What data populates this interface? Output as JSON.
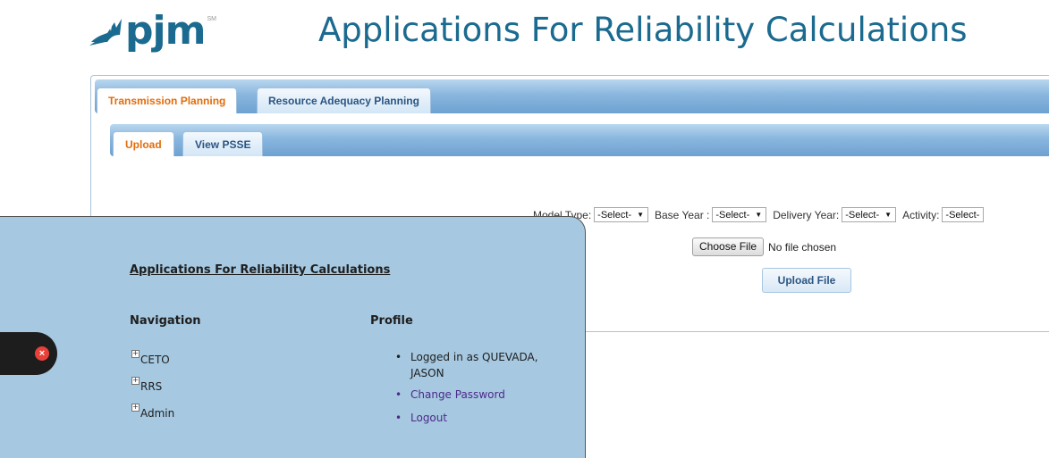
{
  "header": {
    "logo_text": "pjm",
    "logo_mark": "SM",
    "title": "Applications For Reliability Calculations"
  },
  "tabs": [
    {
      "label": "Transmission Planning",
      "active": true
    },
    {
      "label": "Resource Adequacy Planning",
      "active": false
    }
  ],
  "subtabs": [
    {
      "label": "Upload",
      "active": true
    },
    {
      "label": "View PSSE",
      "active": false
    }
  ],
  "filters": {
    "model_type_label": "Model Type:",
    "model_type_value": "-Select-",
    "base_year_label": "Base Year :",
    "base_year_value": "-Select-",
    "delivery_year_label": "Delivery Year:",
    "delivery_year_value": "-Select-",
    "activity_label": "Activity:",
    "activity_value": "-Select-"
  },
  "file": {
    "choose_label": "Choose File",
    "status": "No file chosen"
  },
  "upload_label": "Upload File",
  "overlay": {
    "title": "Applications For Reliability Calculations",
    "navigation_heading": "Navigation",
    "navigation_items": [
      "CETO",
      "RRS",
      "Admin"
    ],
    "profile_heading": "Profile",
    "logged_in": "Logged in as QUEVADA, JASON",
    "change_password": "Change Password",
    "logout": "Logout"
  },
  "icons": {
    "logo": "pjm-logo-icon",
    "close": "close-icon",
    "expand": "plus-expander-icon"
  },
  "colors": {
    "brand_blue": "#1b6a8f",
    "active_tab": "#e36c0a",
    "overlay_bg": "#a6c8e0",
    "link": "#4b2a8a"
  }
}
